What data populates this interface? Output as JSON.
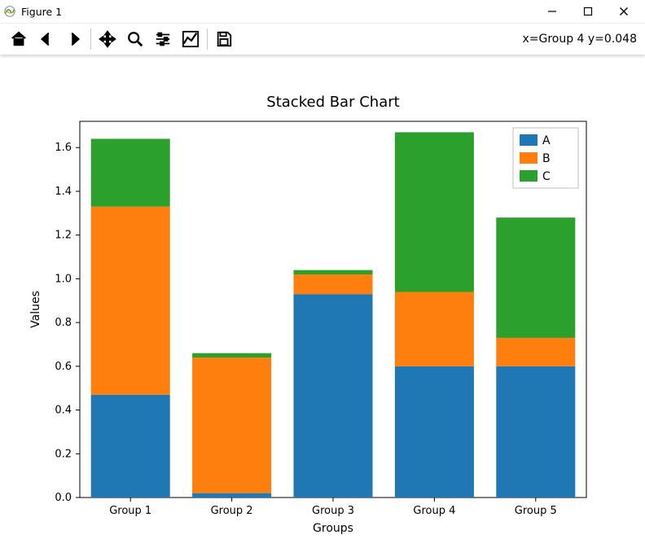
{
  "window": {
    "title": "Figure 1"
  },
  "toolbar": {
    "status": "x=Group 4 y=0.048",
    "buttons": {
      "home": "Home",
      "back": "Back",
      "forward": "Forward",
      "pan": "Pan",
      "zoom": "Zoom",
      "subplots": "Configure subplots",
      "axes": "Edit axis",
      "save": "Save"
    }
  },
  "chart_data": {
    "type": "bar",
    "stacked": true,
    "title": "Stacked Bar Chart",
    "xlabel": "Groups",
    "ylabel": "Values",
    "categories": [
      "Group 1",
      "Group 2",
      "Group 3",
      "Group 4",
      "Group 5"
    ],
    "series": [
      {
        "name": "A",
        "color": "#1f77b4",
        "values": [
          0.47,
          0.02,
          0.93,
          0.6,
          0.6
        ]
      },
      {
        "name": "B",
        "color": "#ff7f0e",
        "values": [
          0.86,
          0.62,
          0.09,
          0.34,
          0.13
        ]
      },
      {
        "name": "C",
        "color": "#2ca02c",
        "values": [
          0.31,
          0.02,
          0.02,
          0.73,
          0.55
        ]
      }
    ],
    "yticks": [
      0.0,
      0.2,
      0.4,
      0.6,
      0.8,
      1.0,
      1.2,
      1.4,
      1.6
    ],
    "ylim": [
      0.0,
      1.72
    ],
    "legend_position": "upper right"
  }
}
